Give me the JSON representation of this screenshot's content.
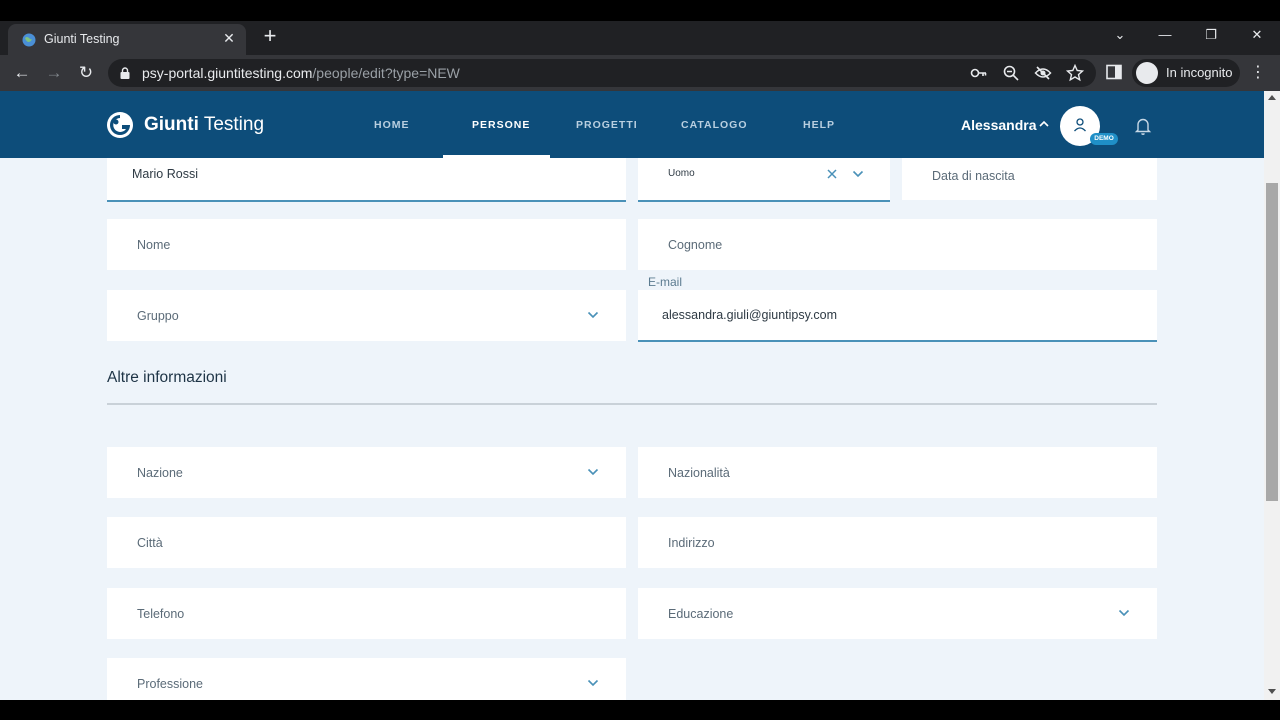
{
  "browser": {
    "tab_title": "Giunti Testing",
    "url_host": "psy-portal.giuntitesting.com",
    "url_path": "/people/edit?type=NEW",
    "incognito_label": "In incognito"
  },
  "header": {
    "brand_bold": "Giunti",
    "brand_light": "Testing",
    "nav": [
      "HOME",
      "PERSONE",
      "PROGETTI",
      "CATALOGO",
      "HELP"
    ],
    "active_nav": "PERSONE",
    "user_name": "Alessandra",
    "badge": "DEMO"
  },
  "form": {
    "full_name_value": "Mario Rossi",
    "gender_value": "Uomo",
    "birth_date_placeholder": "Data di nascita",
    "first_name_placeholder": "Nome",
    "last_name_placeholder": "Cognome",
    "group_placeholder": "Gruppo",
    "email_label": "E-mail",
    "email_value": "alessandra.giuli@giuntipsy.com",
    "section_title": "Altre informazioni",
    "country_placeholder": "Nazione",
    "nationality_placeholder": "Nazionalità",
    "city_placeholder": "Città",
    "address_placeholder": "Indirizzo",
    "phone_placeholder": "Telefono",
    "education_placeholder": "Educazione",
    "profession_placeholder": "Professione"
  },
  "colors": {
    "header_bg": "#0d4d7a",
    "page_bg": "#eef4fa",
    "accent": "#4a91b8"
  }
}
